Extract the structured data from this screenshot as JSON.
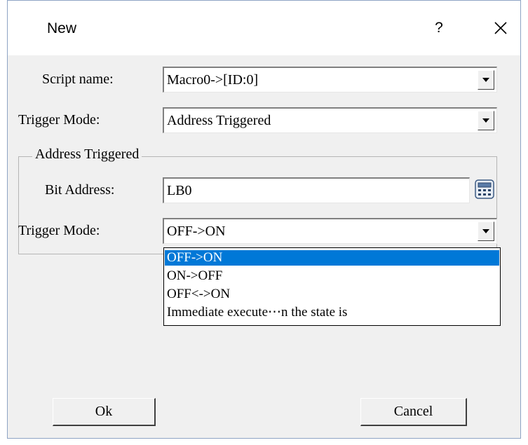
{
  "window": {
    "title": "New",
    "help_label": "?"
  },
  "script_name": {
    "label": "Script name:",
    "value": "Macro0->[ID:0]"
  },
  "trigger_mode": {
    "label": "Trigger Mode:",
    "value": "Address Triggered"
  },
  "address_group": {
    "title": "Address Triggered",
    "bit_address_label": "Bit Address:",
    "bit_address_value": "LB0",
    "trigger_mode_label": "Trigger Mode:",
    "trigger_mode_value": "OFF->ON",
    "options": [
      "OFF->ON",
      "ON->OFF",
      "OFF<->ON",
      "Immediate execute⋯n the state is"
    ],
    "selected_index": 0
  },
  "buttons": {
    "ok": "Ok",
    "cancel": "Cancel"
  },
  "colors": {
    "selection": "#0078d7",
    "dialog_bg": "#f0f0f0"
  },
  "icons": {
    "close": "close-icon",
    "dropdown": "chevron-down-icon",
    "calculator": "calculator-icon"
  }
}
